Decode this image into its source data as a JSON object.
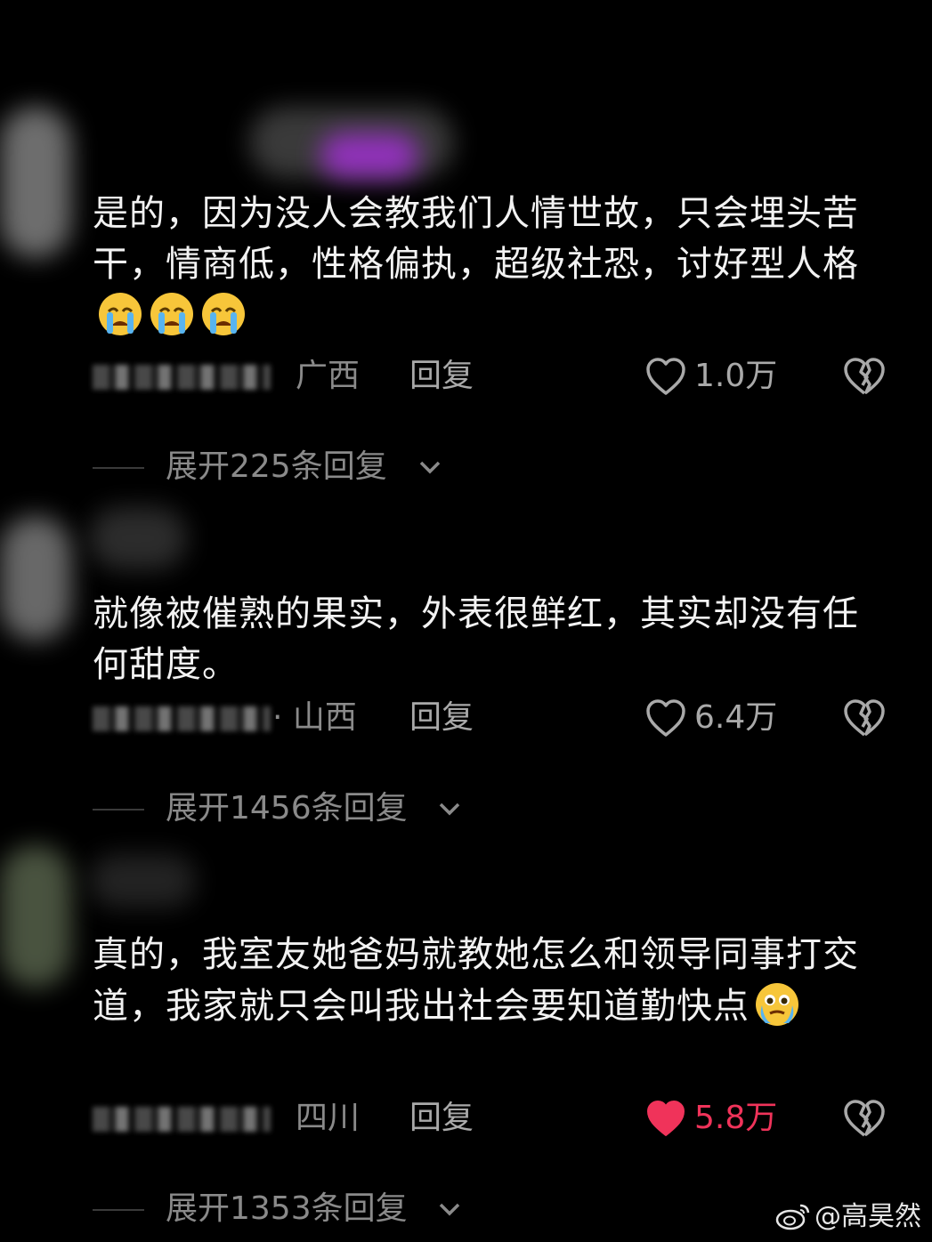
{
  "comments": [
    {
      "text": "是的，因为没人会教我们人情世故，只会埋头苦干，情商低，性格偏执，超级社恐，讨好型人格",
      "emojis": [
        "loudly-crying-face-icon",
        "loudly-crying-face-icon",
        "loudly-crying-face-icon"
      ],
      "region": "广西",
      "reply_label": "回复",
      "likes": "1.0万",
      "liked": false,
      "expand_text": "展开225条回复"
    },
    {
      "text": "就像被催熟的果实，外表很鲜红，其实却没有任何甜度。",
      "emojis": [],
      "region": "· 山西",
      "reply_label": "回复",
      "likes": "6.4万",
      "liked": false,
      "expand_text": "展开1456条回复"
    },
    {
      "text": "真的，我室友她爸妈就教她怎么和领导同事打交道，我家就只会叫我出社会要知道勤快点",
      "emojis": [
        "face-holding-back-tears-icon"
      ],
      "region": "四川",
      "reply_label": "回复",
      "likes": "5.8万",
      "liked": true,
      "expand_text": "展开1353条回复"
    }
  ],
  "watermark": "@高昊然",
  "colors": {
    "background": "#000000",
    "text": "#f2f2f2",
    "muted": "#8a8a8a",
    "like_active": "#f0335a"
  }
}
